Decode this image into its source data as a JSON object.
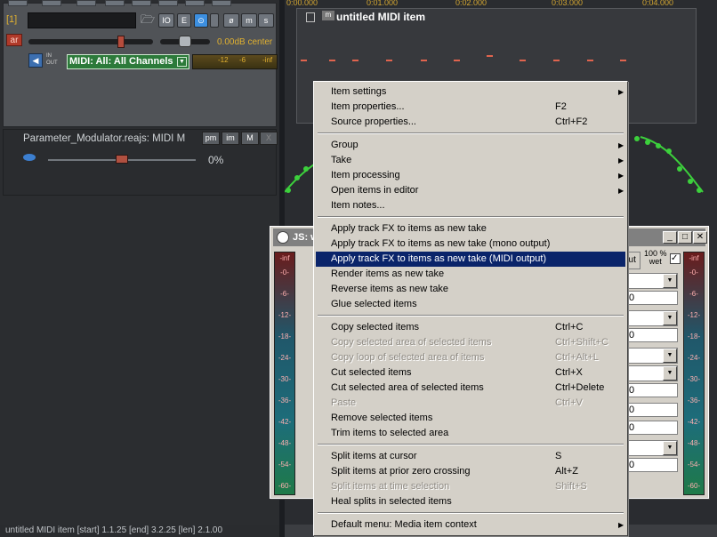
{
  "track": {
    "number": "[1]",
    "arm_label": "ar",
    "volume_readout": "0.00dB center",
    "io_in": "IN",
    "io_out": "OUT",
    "input_select": "MIDI: All: All Channels",
    "meter_labels": [
      "-12",
      "-6",
      "-inf"
    ],
    "buttons": {
      "io": "IO",
      "env": "E",
      "fx": "⊙",
      "phase": "ø",
      "mute": "m",
      "solo": "s"
    }
  },
  "fx": {
    "name": "Parameter_Modulator.reajs: MIDI M",
    "pm": "pm",
    "im": "im",
    "mute": "M",
    "close": "X",
    "value": "0%"
  },
  "status_bar": "untitled MIDI item [start] 1.1.25 [end] 3.2.25 [len] 2.1.00",
  "timeline": [
    "0:00.000",
    "0:01.000",
    "0:02.000",
    "0:03.000",
    "0:04.000"
  ],
  "item": {
    "title": "untitled MIDI item",
    "m_badge": "m"
  },
  "js_window": {
    "title": "JS: w",
    "out_label": "out",
    "wet_label_1": "100 %",
    "wet_label_2": "wet",
    "check": "✓",
    "vu_scale": [
      "-inf",
      "-0-",
      "-6-",
      "-12-",
      "-18-",
      "-24-",
      "-30-",
      "-36-",
      "-42-",
      "-48-",
      "-54-",
      "-60-"
    ],
    "field_value": "0"
  },
  "context_menu": {
    "items": [
      {
        "label": "Item settings",
        "shortcut": "",
        "submenu": true,
        "disabled": false
      },
      {
        "label": "Item properties...",
        "shortcut": "F2",
        "submenu": false,
        "disabled": false
      },
      {
        "label": "Source properties...",
        "shortcut": "Ctrl+F2",
        "submenu": false,
        "disabled": false
      },
      {
        "label": "Group",
        "shortcut": "",
        "submenu": true,
        "disabled": false
      },
      {
        "label": "Take",
        "shortcut": "",
        "submenu": true,
        "disabled": false
      },
      {
        "label": "Item processing",
        "shortcut": "",
        "submenu": true,
        "disabled": false
      },
      {
        "label": "Open items in editor",
        "shortcut": "",
        "submenu": true,
        "disabled": false
      },
      {
        "label": "Item notes...",
        "shortcut": "",
        "submenu": false,
        "disabled": false
      },
      {
        "label": "Apply track FX to items as new take",
        "shortcut": "",
        "submenu": false,
        "disabled": false
      },
      {
        "label": "Apply track FX to items as new take (mono output)",
        "shortcut": "",
        "submenu": false,
        "disabled": false
      },
      {
        "label": "Apply track FX to items as new take (MIDI output)",
        "shortcut": "",
        "submenu": false,
        "disabled": false,
        "highlighted": true
      },
      {
        "label": "Render items as new take",
        "shortcut": "",
        "submenu": false,
        "disabled": false
      },
      {
        "label": "Reverse items as new take",
        "shortcut": "",
        "submenu": false,
        "disabled": false
      },
      {
        "label": "Glue selected items",
        "shortcut": "",
        "submenu": false,
        "disabled": false
      },
      {
        "label": "Copy selected items",
        "shortcut": "Ctrl+C",
        "submenu": false,
        "disabled": false
      },
      {
        "label": "Copy selected area of selected items",
        "shortcut": "Ctrl+Shift+C",
        "submenu": false,
        "disabled": true
      },
      {
        "label": "Copy loop of selected area of items",
        "shortcut": "Ctrl+Alt+L",
        "submenu": false,
        "disabled": true
      },
      {
        "label": "Cut selected items",
        "shortcut": "Ctrl+X",
        "submenu": false,
        "disabled": false
      },
      {
        "label": "Cut selected area of selected items",
        "shortcut": "Ctrl+Delete",
        "submenu": false,
        "disabled": false
      },
      {
        "label": "Paste",
        "shortcut": "Ctrl+V",
        "submenu": false,
        "disabled": true
      },
      {
        "label": "Remove selected items",
        "shortcut": "",
        "submenu": false,
        "disabled": false
      },
      {
        "label": "Trim items to selected area",
        "shortcut": "",
        "submenu": false,
        "disabled": false
      },
      {
        "label": "Split items at cursor",
        "shortcut": "S",
        "submenu": false,
        "disabled": false
      },
      {
        "label": "Split items at prior zero crossing",
        "shortcut": "Alt+Z",
        "submenu": false,
        "disabled": false
      },
      {
        "label": "Split items at time selection",
        "shortcut": "Shift+S",
        "submenu": false,
        "disabled": true
      },
      {
        "label": "Heal splits in selected items",
        "shortcut": "",
        "submenu": false,
        "disabled": false
      },
      {
        "label": "Default menu: Media item context",
        "shortcut": "",
        "submenu": true,
        "disabled": false
      }
    ]
  }
}
